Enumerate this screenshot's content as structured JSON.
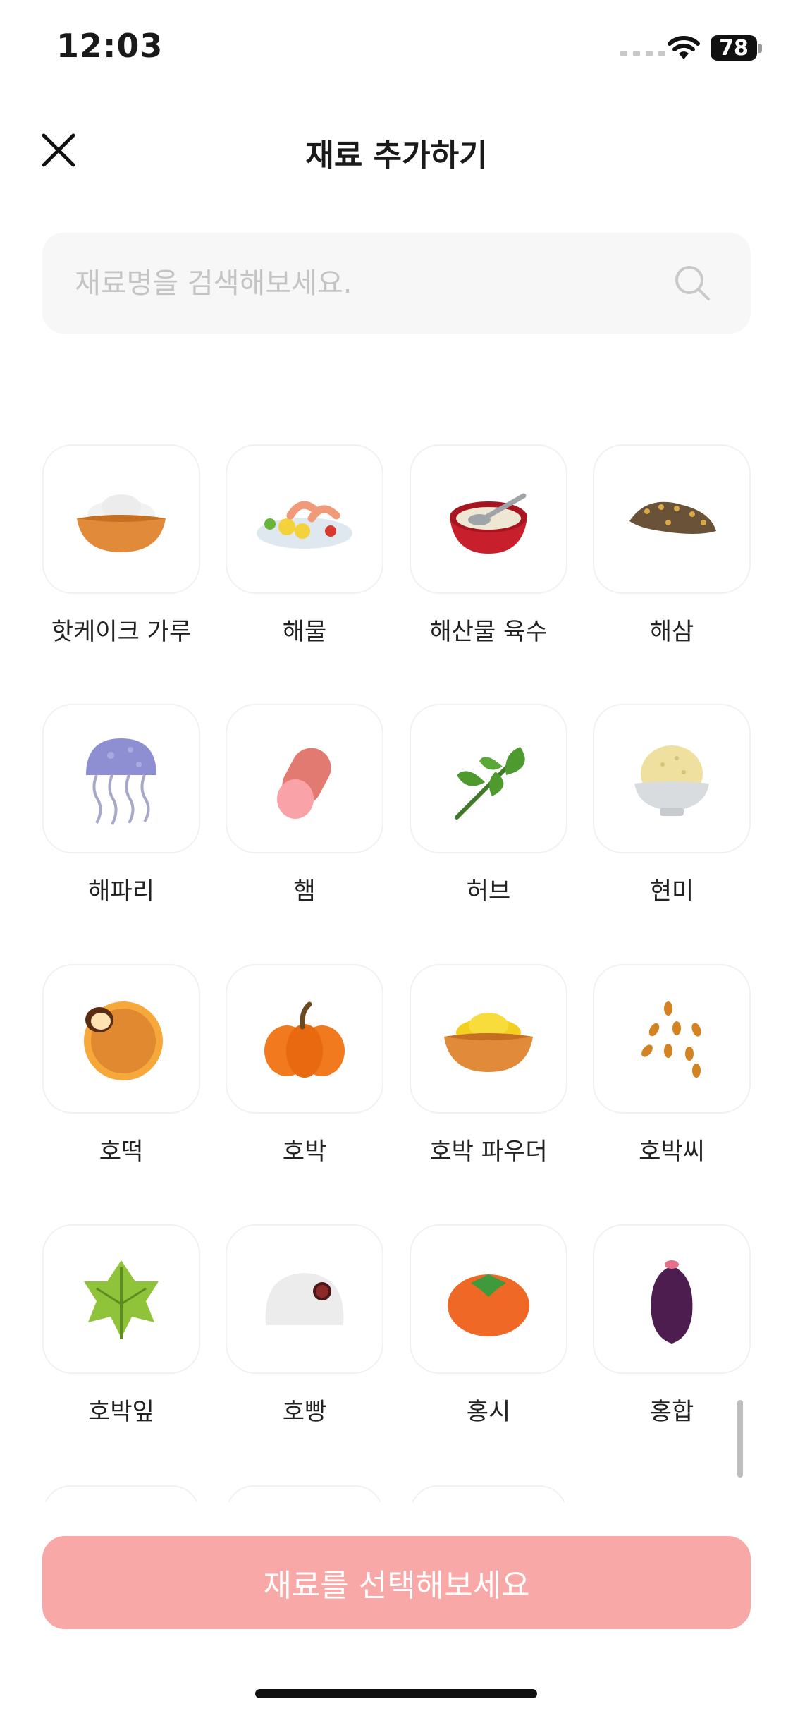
{
  "status_bar": {
    "time": "12:03",
    "battery": "78"
  },
  "header": {
    "title": "재료 추가하기",
    "close_icon": "close-icon"
  },
  "search": {
    "placeholder": "재료명을 검색해보세요.",
    "value": "",
    "icon": "search-icon"
  },
  "ingredients": [
    {
      "label": "핫케이크 가루",
      "icon": "pancake-flour-icon"
    },
    {
      "label": "해물",
      "icon": "seafood-icon"
    },
    {
      "label": "해산물 육수",
      "icon": "seafood-broth-icon"
    },
    {
      "label": "해삼",
      "icon": "sea-cucumber-icon"
    },
    {
      "label": "해파리",
      "icon": "jellyfish-icon"
    },
    {
      "label": "햄",
      "icon": "ham-icon"
    },
    {
      "label": "허브",
      "icon": "herb-icon"
    },
    {
      "label": "현미",
      "icon": "brown-rice-icon"
    },
    {
      "label": "호떡",
      "icon": "hotteok-icon"
    },
    {
      "label": "호박",
      "icon": "pumpkin-icon"
    },
    {
      "label": "호박 파우더",
      "icon": "pumpkin-powder-icon"
    },
    {
      "label": "호박씨",
      "icon": "pumpkin-seeds-icon"
    },
    {
      "label": "호박잎",
      "icon": "pumpkin-leaf-icon"
    },
    {
      "label": "호빵",
      "icon": "steamed-bun-icon"
    },
    {
      "label": "홍시",
      "icon": "persimmon-icon"
    },
    {
      "label": "홍합",
      "icon": "mussel-icon"
    }
  ],
  "bottom_button": {
    "label": "재료를 선택해보세요",
    "color": "#f9a8a8"
  }
}
